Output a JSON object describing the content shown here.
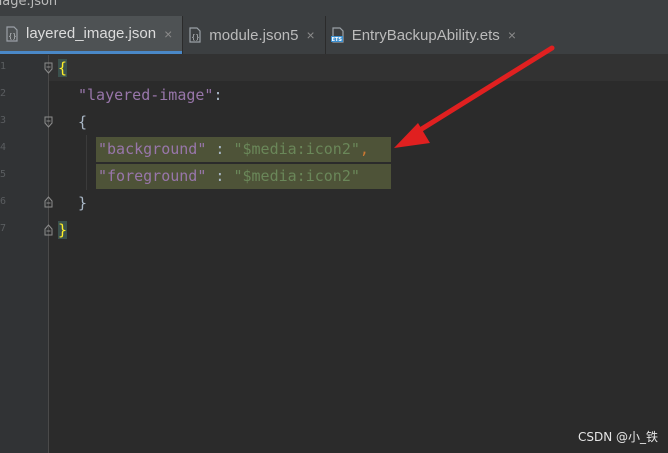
{
  "window": {
    "title": "nage.json"
  },
  "tabs": [
    {
      "label": "layered_image.json",
      "icon": "json-file-icon",
      "active": true
    },
    {
      "label": "module.json5",
      "icon": "json-file-icon",
      "active": false
    },
    {
      "label": "EntryBackupAbility.ets",
      "icon": "ets-file-icon",
      "active": false,
      "icon_text": "ETS"
    }
  ],
  "close_glyph": "×",
  "line_numbers": [
    "1",
    "2",
    "3",
    "4",
    "5",
    "6",
    "7"
  ],
  "code": {
    "line1": {
      "brace": "{"
    },
    "line2": {
      "key": "\"layered-image\"",
      "colon": ":"
    },
    "line3": {
      "brace": "{"
    },
    "line4": {
      "key": "\"background\"",
      "colon": " : ",
      "value": "\"$media:icon2\"",
      "comma": ","
    },
    "line5": {
      "key": "\"foreground\"",
      "colon": " : ",
      "value": "\"$media:icon2\""
    },
    "line6": {
      "brace": "}"
    },
    "line7": {
      "brace": "}"
    }
  },
  "annotation": {
    "arrow_color": "#e02020"
  },
  "watermark": "CSDN @小_铁"
}
